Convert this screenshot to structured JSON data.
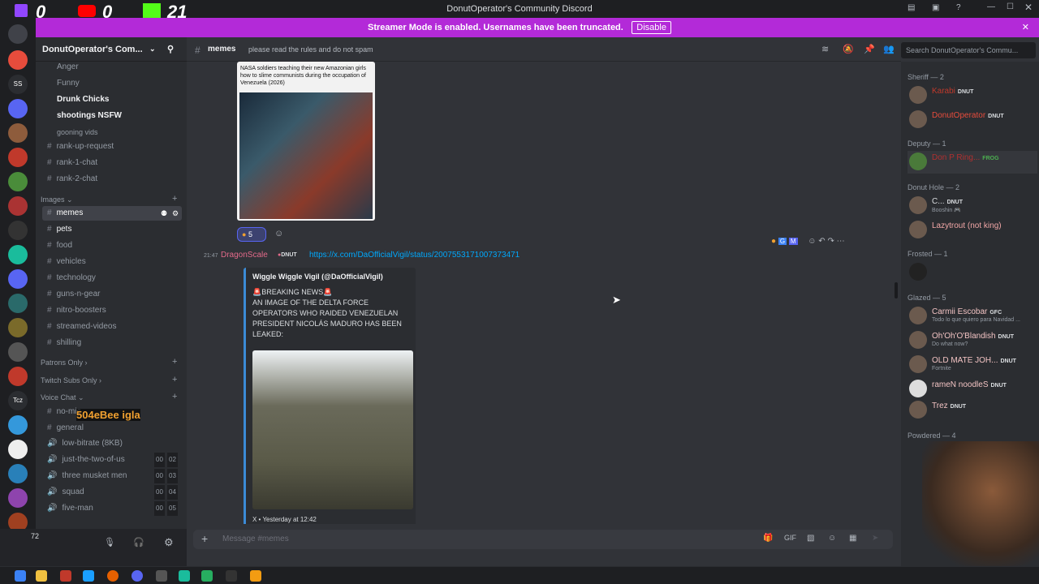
{
  "window": {
    "title": "DonutOperator's Community Discord"
  },
  "overlay": {
    "twitch_count": "0",
    "youtube_count": "0",
    "kick_count": "21",
    "webcam_caption": "504eBee igla"
  },
  "streamer_banner": {
    "message": "Streamer Mode is enabled. Usernames have been truncated.",
    "disable_label": "Disable"
  },
  "server": {
    "name": "DonutOperator's Com..."
  },
  "channels": {
    "top": [
      {
        "label": "Anger"
      },
      {
        "label": "Funny"
      },
      {
        "label": "Drunk Chicks"
      },
      {
        "label": "shootings NSFW"
      },
      {
        "label": "gooning vids"
      }
    ],
    "text": [
      {
        "label": "rank-up-request"
      },
      {
        "label": "rank-1-chat"
      },
      {
        "label": "rank-2-chat"
      }
    ],
    "images_category": "Images",
    "images": [
      {
        "label": "memes"
      },
      {
        "label": "pets"
      },
      {
        "label": "food"
      },
      {
        "label": "vehicles"
      },
      {
        "label": "technology"
      },
      {
        "label": "guns-n-gear"
      },
      {
        "label": "nitro-boosters"
      },
      {
        "label": "streamed-videos"
      },
      {
        "label": "shilling"
      }
    ],
    "patrons_category": "Patrons Only",
    "twitch_category": "Twitch Subs Only",
    "voice_category": "Voice Chat",
    "voice": [
      {
        "label": "no-mic"
      },
      {
        "label": "general"
      },
      {
        "label": "low-bitrate (8KB)"
      },
      {
        "label": "just-the-two-of-us",
        "a": "00",
        "b": "02"
      },
      {
        "label": "three musket men",
        "a": "00",
        "b": "03"
      },
      {
        "label": "squad",
        "a": "00",
        "b": "04"
      },
      {
        "label": "five-man",
        "a": "00",
        "b": "05"
      }
    ]
  },
  "chat_header": {
    "channel": "memes",
    "topic": "please read the rules and do not spam",
    "search_placeholder": "Search DonutOperator's Commu..."
  },
  "messages": {
    "first_image_caption": "NASA soldiers teaching their new Amazonian girls how to slime communists during the occupation of Venezuela (2026)",
    "first_reaction_count": "5",
    "second": {
      "time": "21:47",
      "author": "DragonScale",
      "badge": "DNUT",
      "link": "https://x.com/DaOfficialVigil/status/2007553171007373471",
      "embed_author": "Wiggle Wiggle Vigil (@DaOfficialVigil)",
      "embed_text": "🚨BREAKING NEWS🚨\nAN IMAGE OF THE DELTA FORCE OPERATORS WHO RAIDED VENEZUELAN PRESIDENT NICOLÁS MADURO HAS BEEN LEAKED:",
      "embed_footer": "X • Yesterday at 12:42"
    }
  },
  "composer": {
    "placeholder": "Message #memes"
  },
  "members": {
    "categories": [
      {
        "name": "Sheriff — 2"
      },
      {
        "name": "Deputy — 1"
      },
      {
        "name": "Donut Hole — 2"
      },
      {
        "name": "Frosted — 1"
      },
      {
        "name": "Glazed — 5"
      },
      {
        "name": "Powdered — 4"
      }
    ],
    "list": [
      {
        "name": "Karabi",
        "badge": "DNUT",
        "sub": "",
        "color": "#c0392b"
      },
      {
        "name": "DonutOperator",
        "badge": "DNUT",
        "sub": "",
        "color": "#e74c3c"
      },
      {
        "name": "Don P Ring...",
        "badge": "FROG",
        "sub": "",
        "color": "#b03030"
      },
      {
        "name": "C...",
        "badge": "DNUT",
        "sub": "Booshin 🎮",
        "color": "#dbdee1"
      },
      {
        "name": "Lazytrout (not king)",
        "badge": "",
        "sub": "",
        "color": "#f2a7a7"
      },
      {
        "name": "",
        "badge": "",
        "sub": "",
        "color": "#dbdee1"
      },
      {
        "name": "Carmii Escobar",
        "badge": "GFC",
        "sub": "Todo lo que quiero para Navidad ...",
        "color": "#f2c3c3"
      },
      {
        "name": "Oh'Oh'O'Blandish",
        "badge": "DNUT",
        "sub": "Do what now?",
        "color": "#f2c3c3"
      },
      {
        "name": "OLD MATE JOH...",
        "badge": "DNUT",
        "sub": "Fortnite",
        "color": "#f2c3c3"
      },
      {
        "name": "rameN noodleS",
        "badge": "DNUT",
        "sub": "",
        "color": "#f2c3c3"
      },
      {
        "name": "Trez",
        "badge": "DNUT",
        "sub": "",
        "color": "#f2c3c3"
      }
    ]
  },
  "usercard": {
    "count": "72"
  },
  "colors": {
    "accent": "#b32ad8",
    "blurple": "#5865f2",
    "link": "#00a8fc"
  }
}
